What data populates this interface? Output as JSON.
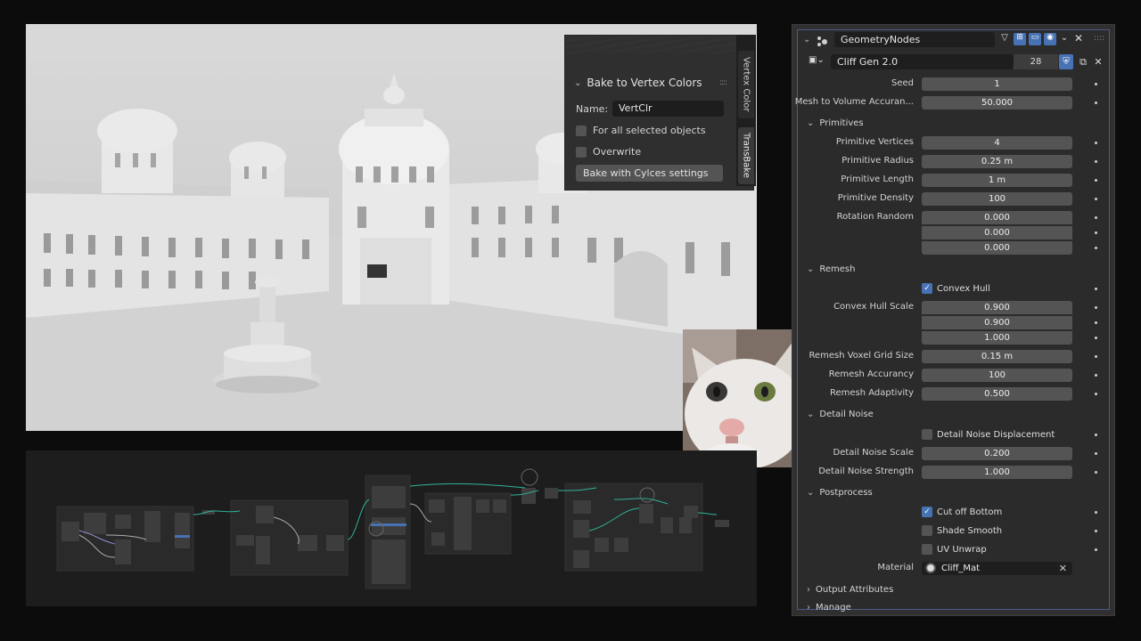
{
  "bake_panel": {
    "title": "Bake to Vertex Colors",
    "name_label": "Name:",
    "name_value": "VertClr",
    "for_all_label": "For all selected objects",
    "overwrite_label": "Overwrite",
    "bake_button": "Bake with Cylces settings"
  },
  "side_tabs": [
    "Vertex Color",
    "TransBake"
  ],
  "modifier": {
    "name": "GeometryNodes",
    "node_group": "Cliff Gen 2.0",
    "users": "28"
  },
  "props": {
    "seed_label": "Seed",
    "seed": "1",
    "mesh_acc_label": "Mesh to Volume Accuran...",
    "mesh_acc": "50.000",
    "primitives": "Primitives",
    "prim_vert_label": "Primitive Vertices",
    "prim_vert": "4",
    "prim_radius_label": "Primitive Radius",
    "prim_radius": "0.25 m",
    "prim_length_label": "Primitive Length",
    "prim_length": "1 m",
    "prim_density_label": "Primitive Density",
    "prim_density": "100",
    "rot_label": "Rotation Random",
    "rot_x": "0.000",
    "rot_y": "0.000",
    "rot_z": "0.000",
    "remesh": "Remesh",
    "convex_hull": "Convex Hull",
    "hull_scale_label": "Convex Hull Scale",
    "hull_x": "0.900",
    "hull_y": "0.900",
    "hull_z": "1.000",
    "voxel_label": "Remesh Voxel Grid Size",
    "voxel": "0.15 m",
    "rem_acc_label": "Remesh Accurancy",
    "rem_acc": "100",
    "rem_adapt_label": "Remesh Adaptivity",
    "rem_adapt": "0.500",
    "detail_noise": "Detail Noise",
    "dn_disp": "Detail Noise Displacement",
    "dn_scale_label": "Detail Noise Scale",
    "dn_scale": "0.200",
    "dn_strength_label": "Detail Noise Strength",
    "dn_strength": "1.000",
    "postprocess": "Postprocess",
    "cut_bottom": "Cut off Bottom",
    "shade_smooth": "Shade Smooth",
    "uv_unwrap": "UV Unwrap",
    "material_label": "Material",
    "material": "Cliff_Mat",
    "output_attrs": "Output Attributes",
    "manage": "Manage"
  },
  "colors": {
    "accent": "#4772b3",
    "panel": "#2b2b2b",
    "field": "#545454"
  }
}
